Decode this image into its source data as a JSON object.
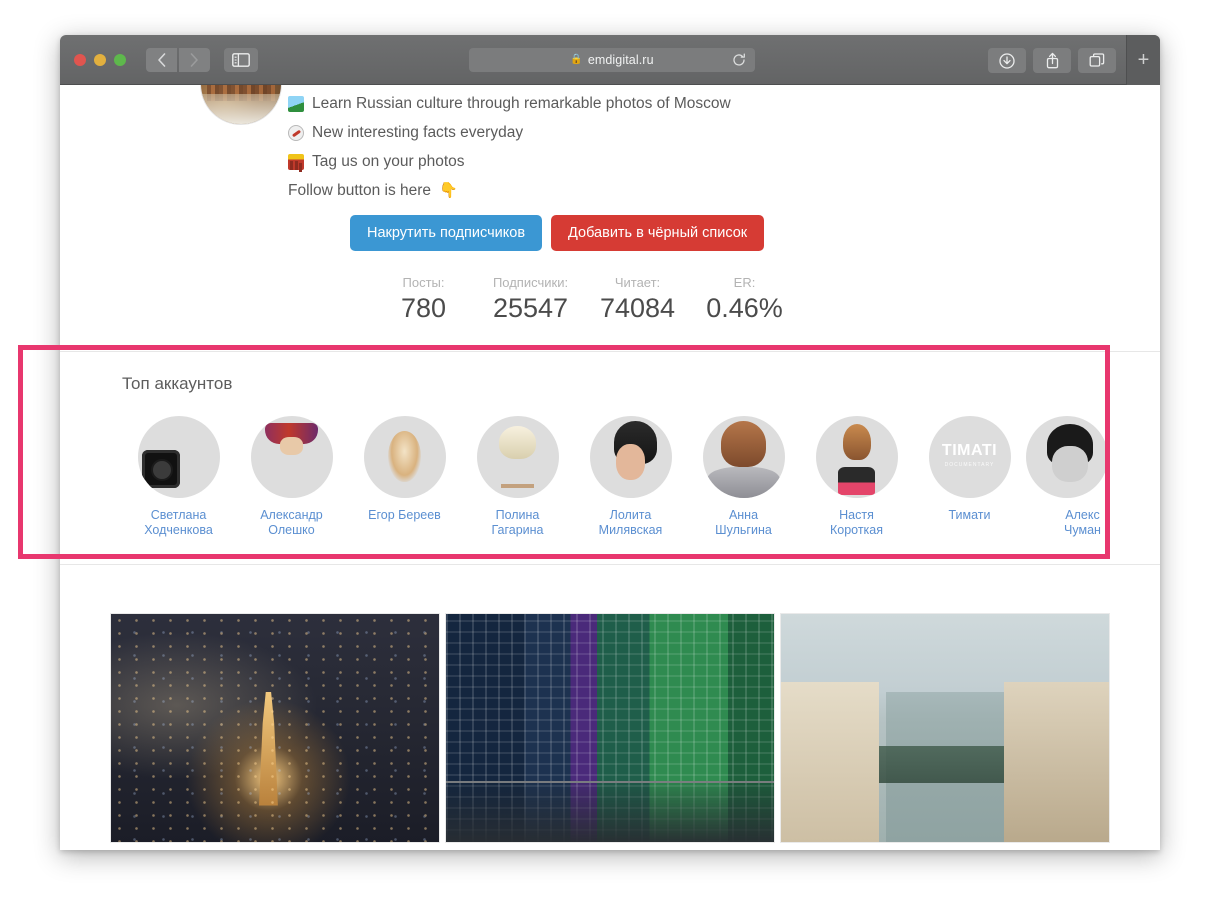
{
  "browser": {
    "traffic_lights": [
      "close",
      "minimize",
      "zoom"
    ],
    "back_label": "‹",
    "forward_label": "›",
    "sidebar_icon": "sidebar-icon",
    "url": "emdigital.ru",
    "lock_icon": "lock-icon",
    "reload_icon": "reload-icon",
    "download_icon": "download-icon",
    "share_icon": "share-icon",
    "tabs_icon": "tabs-icon",
    "new_tab_label": "+"
  },
  "profile": {
    "bio_lines": [
      {
        "icon": "photo-emoji",
        "text": "Learn Russian culture through remarkable photos of Moscow"
      },
      {
        "icon": "compass-emoji",
        "text": "New interesting facts everyday"
      },
      {
        "icon": "cityscape-emoji",
        "text": "Tag us on your photos"
      },
      {
        "icon": "point-down-emoji",
        "text": "Follow button is here"
      }
    ],
    "buttons": {
      "promote": "Накрутить подписчиков",
      "blacklist": "Добавить в чёрный список"
    },
    "stats": [
      {
        "label": "Посты:",
        "value": "780"
      },
      {
        "label": "Подписчики:",
        "value": "25547"
      },
      {
        "label": "Читает:",
        "value": "74084"
      },
      {
        "label": "ER:",
        "value": "0.46%"
      }
    ]
  },
  "top_accounts": {
    "title": "Топ аккаунтов",
    "items": [
      {
        "first": "Светлана",
        "last": "Ходченкова",
        "avatar": "av1"
      },
      {
        "first": "Александр",
        "last": "Олешко",
        "avatar": "av2"
      },
      {
        "first": "Егор Береев",
        "last": "",
        "avatar": "av3"
      },
      {
        "first": "Полина",
        "last": "Гагарина",
        "avatar": "av4"
      },
      {
        "first": "Лолита",
        "last": "Милявская",
        "avatar": "av5"
      },
      {
        "first": "Анна",
        "last": "Шульгина",
        "avatar": "av6"
      },
      {
        "first": "Настя",
        "last": "Короткая",
        "avatar": "av7"
      },
      {
        "first": "Тимати",
        "last": "",
        "avatar": "av8"
      },
      {
        "first": "Алекс",
        "last": "Чуман",
        "avatar": "av9"
      }
    ],
    "timati_logo": "TIMATI",
    "timati_sub": "DOCUMENTARY"
  },
  "photos": [
    {
      "name": "moscow-night-aerial"
    },
    {
      "name": "moscow-city-towers-night"
    },
    {
      "name": "boulevard-vintage-view"
    }
  ],
  "annotation": {
    "color": "#e8376e"
  }
}
